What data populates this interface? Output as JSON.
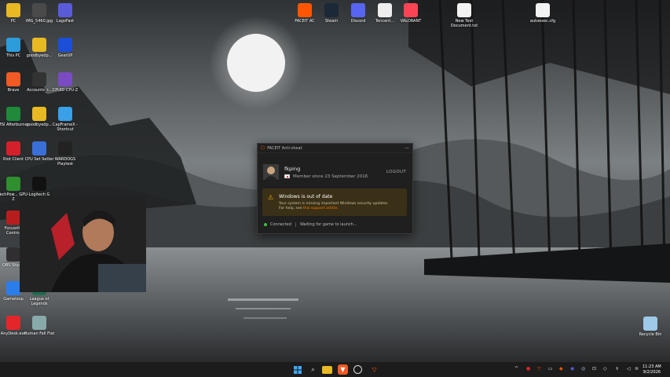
{
  "desktop": {
    "icons": [
      {
        "label": "PC",
        "icon": "folder-icon",
        "color": "#e8b923"
      },
      {
        "label": "IMG_5460.jpg",
        "icon": "image-icon",
        "color": "#4a4a4a"
      },
      {
        "label": "LagoFast",
        "icon": "lagofast-icon",
        "color": "#5a5bd8"
      },
      {
        "label": "This PC",
        "icon": "computer-icon",
        "color": "#2d9cdb"
      },
      {
        "label": "goodbyedp...",
        "icon": "folder-icon",
        "color": "#e8b923"
      },
      {
        "label": "GearUP",
        "icon": "gearup-icon",
        "color": "#1b4fd8"
      },
      {
        "label": "Brave",
        "icon": "brave-icon",
        "color": "#f15a24"
      },
      {
        "label": "Accounts_r...",
        "icon": "exe-icon",
        "color": "#333"
      },
      {
        "label": "CPUID CPU-Z",
        "icon": "cpuz-icon",
        "color": "#7a4bc2"
      },
      {
        "label": "MSI Afterburner",
        "icon": "msi-icon",
        "color": "#1e8a3a"
      },
      {
        "label": "goodbyedp...",
        "icon": "folder-icon",
        "color": "#e8b923"
      },
      {
        "label": "CapFrameX - Shortcut",
        "icon": "capframex-icon",
        "color": "#3aa0e8"
      },
      {
        "label": "Riot Client",
        "icon": "riot-icon",
        "color": "#d3202b"
      },
      {
        "label": "CPU Set Setter",
        "icon": "cpu-icon",
        "color": "#3a6fd8"
      },
      {
        "label": "WARDOGS Playtest",
        "icon": "wardogs-icon",
        "color": "#222"
      },
      {
        "label": "TechPow... GPU-Z",
        "icon": "gpuz-icon",
        "color": "#2f8f2f"
      },
      {
        "label": "Logitech G",
        "icon": "logitech-icon",
        "color": "#111"
      },
      {
        "label": "Focusrite Control",
        "icon": "focusrite-icon",
        "color": "#b81d1d"
      },
      {
        "label": "OBS Studio",
        "icon": "obs-icon",
        "color": "#302e31"
      },
      {
        "label": "Gameloop",
        "icon": "gameloop-icon",
        "color": "#2b7de9"
      },
      {
        "label": "League of Legends",
        "icon": "lol-icon",
        "color": "#1f6b4f"
      },
      {
        "label": "AnyDesk.exe",
        "icon": "anydesk-icon",
        "color": "#e3262a"
      },
      {
        "label": "Human Fall Flat",
        "icon": "hff-icon",
        "color": "#8aa"
      },
      {
        "label": "FACEIT AC",
        "icon": "faceit-icon",
        "color": "#ff5500"
      },
      {
        "label": "Steam",
        "icon": "steam-icon",
        "color": "#1b2838"
      },
      {
        "label": "Discord",
        "icon": "discord-icon",
        "color": "#5865f2"
      },
      {
        "label": "Tencent...",
        "icon": "tencent-icon",
        "color": "#eee"
      },
      {
        "label": "VALORANT",
        "icon": "valorant-icon",
        "color": "#fa4454"
      },
      {
        "label": "New Text Document.txt",
        "icon": "text-file-icon",
        "color": "#f2f2f2"
      },
      {
        "label": "autoexec.cfg",
        "icon": "cfg-file-icon",
        "color": "#f2f2f2"
      },
      {
        "label": "Recycle Bin",
        "icon": "recycle-bin-icon",
        "color": "#9ec9e8"
      }
    ]
  },
  "faceit": {
    "title": "FACEIT Anti-cheat",
    "username": "fkping",
    "member_since": "Member since 23 September 2016",
    "logout": "LOGOUT",
    "warning_title": "Windows is out of date",
    "warning_line1": "Your system is missing important Windows security updates.",
    "warning_line2_prefix": "For help, see ",
    "warning_link": "this support article.",
    "status_connected": "Connected",
    "status_waiting": "Waiting for game to launch..."
  },
  "taskbar": {
    "time": "11:23 AM",
    "date": "9/2/2026",
    "pinned": [
      "windows-start-icon",
      "search-icon",
      "file-explorer-icon",
      "brave-icon",
      "faceit-icon",
      "valorant-icon"
    ],
    "tray": [
      "chevron-up-icon",
      "faceit-icon",
      "steam-icon",
      "discord-icon",
      "msi-icon",
      "riot-icon",
      "speaker-icon",
      "wifi-icon",
      "battery-icon"
    ]
  },
  "colors": {
    "accent": "#ff5500",
    "warning": "#f5b400",
    "connected": "#3cc23c"
  }
}
